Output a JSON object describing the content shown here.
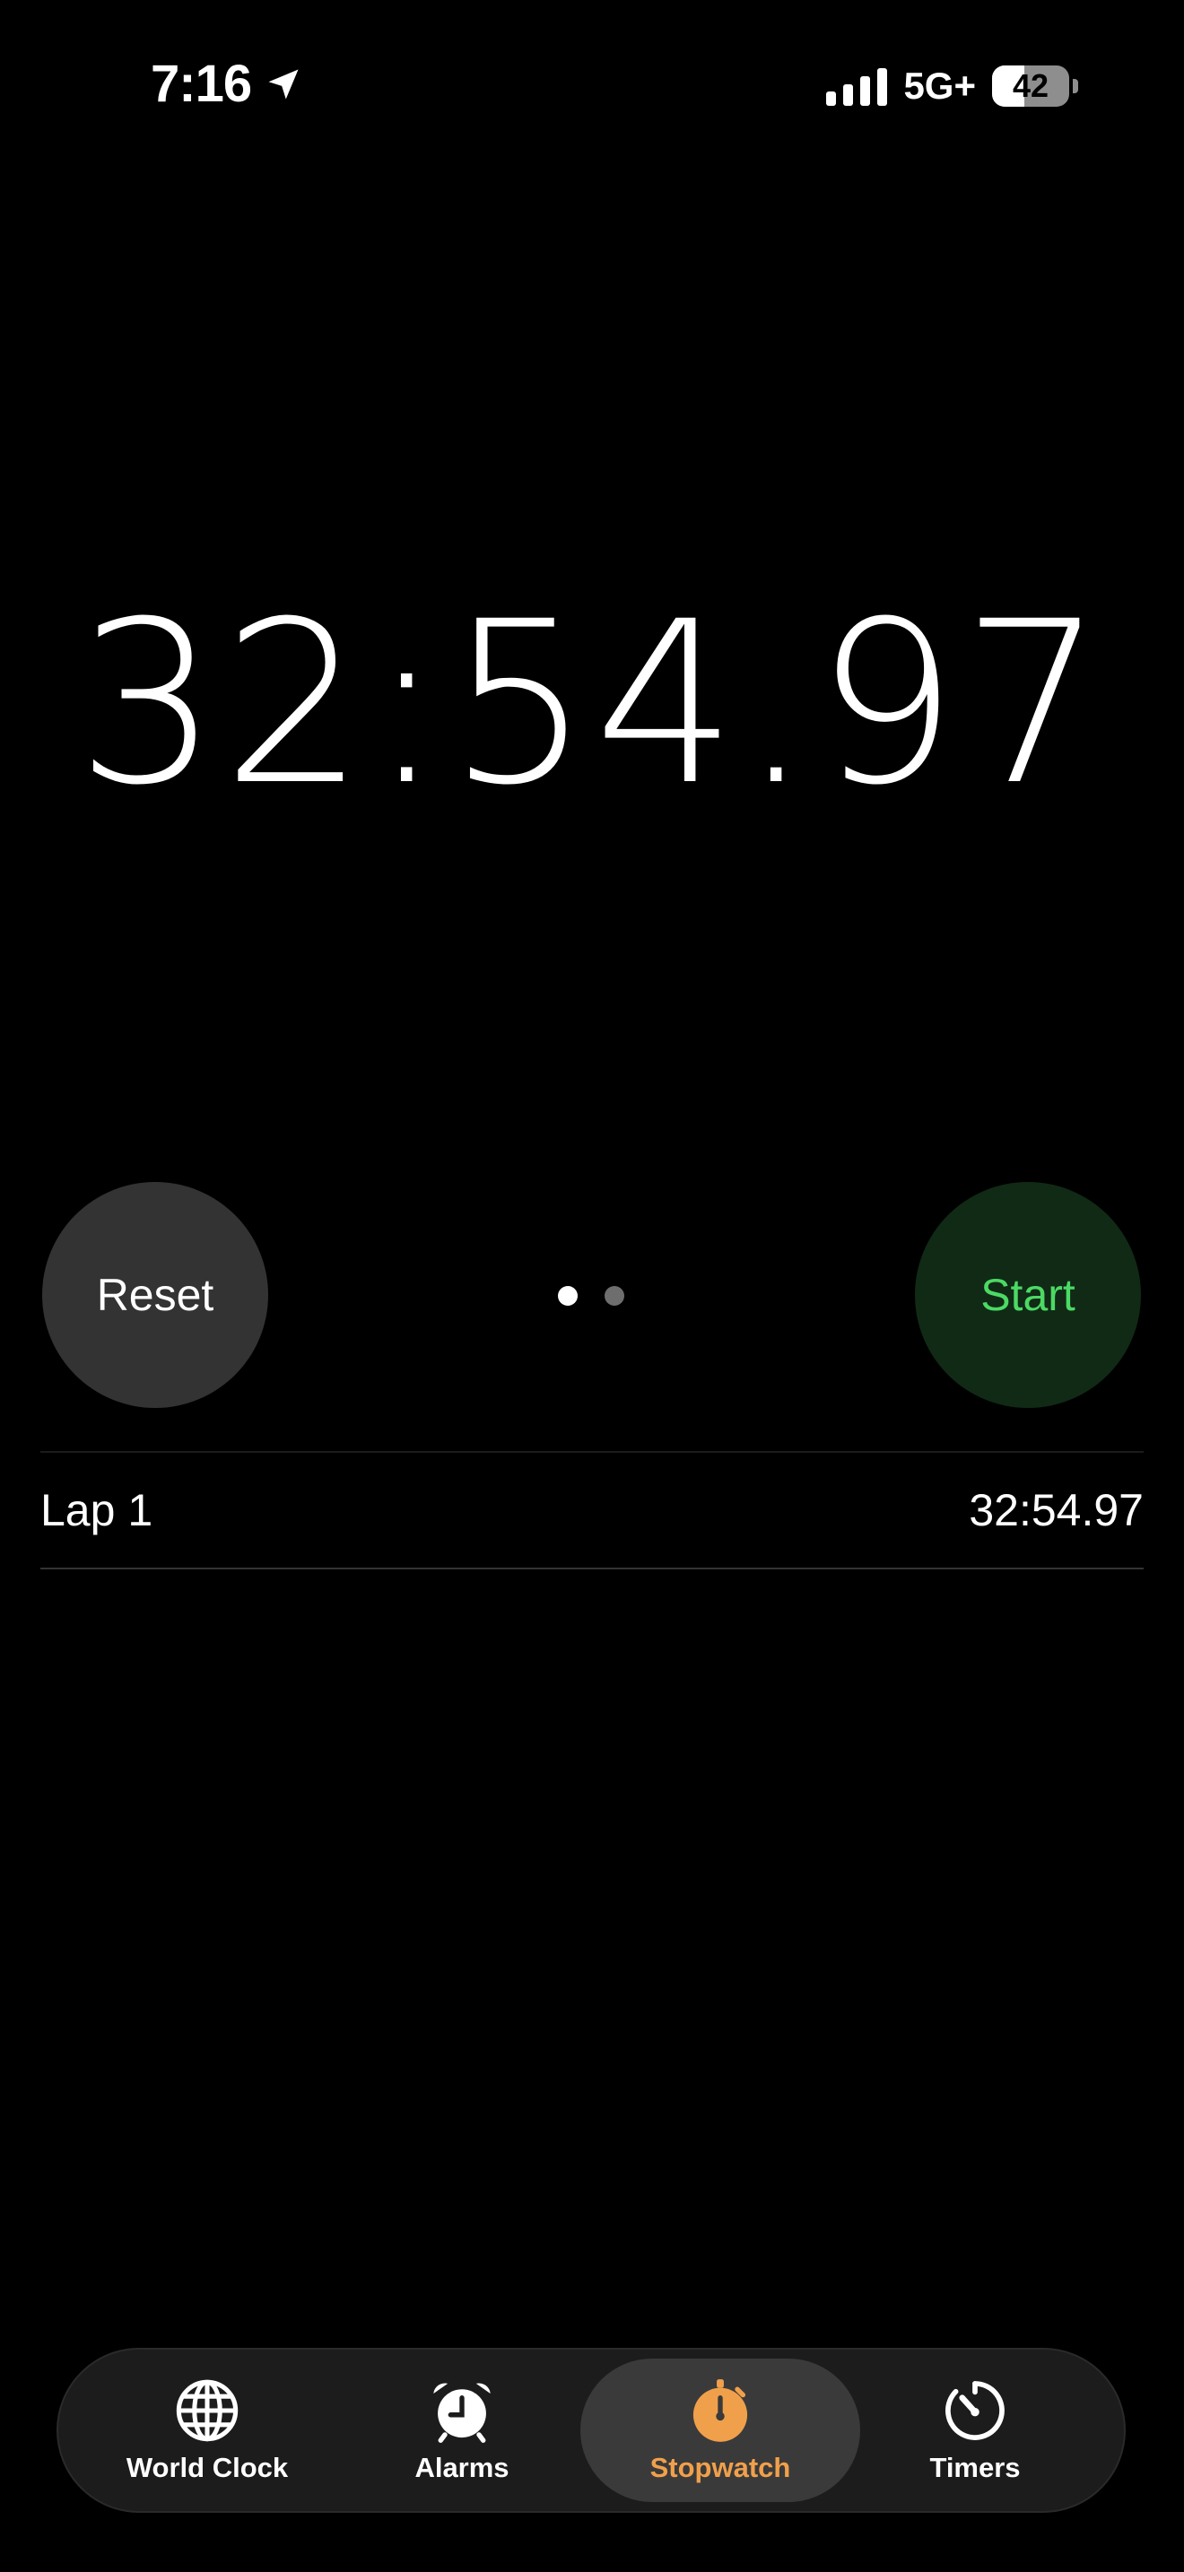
{
  "status_bar": {
    "time": "7:16",
    "network": "5G+",
    "battery_level": "42"
  },
  "stopwatch": {
    "display_time": "32:54.97",
    "reset_label": "Reset",
    "start_label": "Start",
    "page_count": 2,
    "active_page": 1
  },
  "laps": [
    {
      "label": "Lap 1",
      "time": "32:54.97"
    }
  ],
  "tabs": [
    {
      "label": "World Clock",
      "icon": "globe-icon",
      "active": false
    },
    {
      "label": "Alarms",
      "icon": "alarm-clock-icon",
      "active": false
    },
    {
      "label": "Stopwatch",
      "icon": "stopwatch-icon",
      "active": true
    },
    {
      "label": "Timers",
      "icon": "timer-icon",
      "active": false
    }
  ],
  "colors": {
    "background": "#000000",
    "start_text": "#4cd964",
    "start_bg": "#102a16",
    "reset_bg": "#333333",
    "active_tab": "#f0a04b"
  }
}
